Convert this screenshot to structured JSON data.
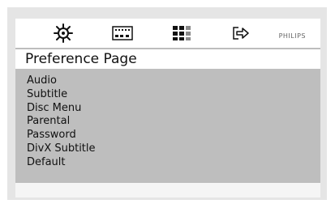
{
  "toolbar": {
    "icons": [
      "settings-gear-icon",
      "display-icon",
      "grid-icon",
      "exit-icon"
    ],
    "brand": "PHILIPS"
  },
  "page": {
    "title": "Preference Page"
  },
  "menu": {
    "items": [
      "Audio",
      "Subtitle",
      "Disc Menu",
      "Parental",
      "Password",
      "DivX Subtitle",
      "Default"
    ]
  },
  "colors": {
    "frame": "#e5e5e5",
    "menu_panel": "#bebebe",
    "page_bar": "#ffffff",
    "text": "#111111"
  }
}
